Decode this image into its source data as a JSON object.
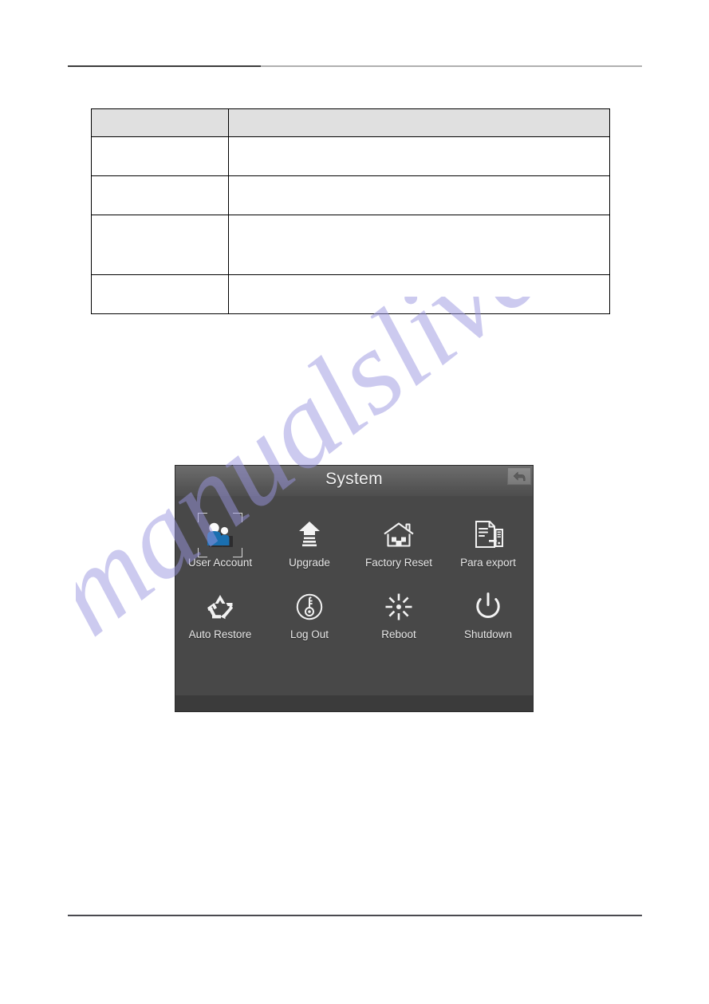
{
  "document": {
    "header_rule": true,
    "footer_rule": true,
    "watermark_text": "manualslive.com",
    "watermark_color": "#9a96e0"
  },
  "table": {
    "columns": [
      "",
      ""
    ],
    "header": [
      "",
      ""
    ],
    "rows": [
      [
        "",
        ""
      ],
      [
        "",
        ""
      ],
      [
        "",
        ""
      ],
      [
        "",
        ""
      ]
    ]
  },
  "dialog": {
    "title": "System",
    "back_icon": "back-arrow-icon",
    "background_color": "#484848",
    "titlebar_color": "#626262",
    "accent_color": "#1a6fb0",
    "label_color": "#e9e9e9",
    "selected_item": "User Account",
    "items": [
      {
        "label": "User Account",
        "icon": "users-icon",
        "selected": true
      },
      {
        "label": "Upgrade",
        "icon": "upload-arrow-icon",
        "selected": false
      },
      {
        "label": "Factory Reset",
        "icon": "house-icon",
        "selected": false
      },
      {
        "label": "Para export",
        "icon": "document-export-icon",
        "selected": false
      },
      {
        "label": "Auto Restore",
        "icon": "recycle-icon",
        "selected": false
      },
      {
        "label": "Log Out",
        "icon": "key-circle-icon",
        "selected": false
      },
      {
        "label": "Reboot",
        "icon": "sunburst-icon",
        "selected": false
      },
      {
        "label": "Shutdown",
        "icon": "power-icon",
        "selected": false
      }
    ]
  }
}
